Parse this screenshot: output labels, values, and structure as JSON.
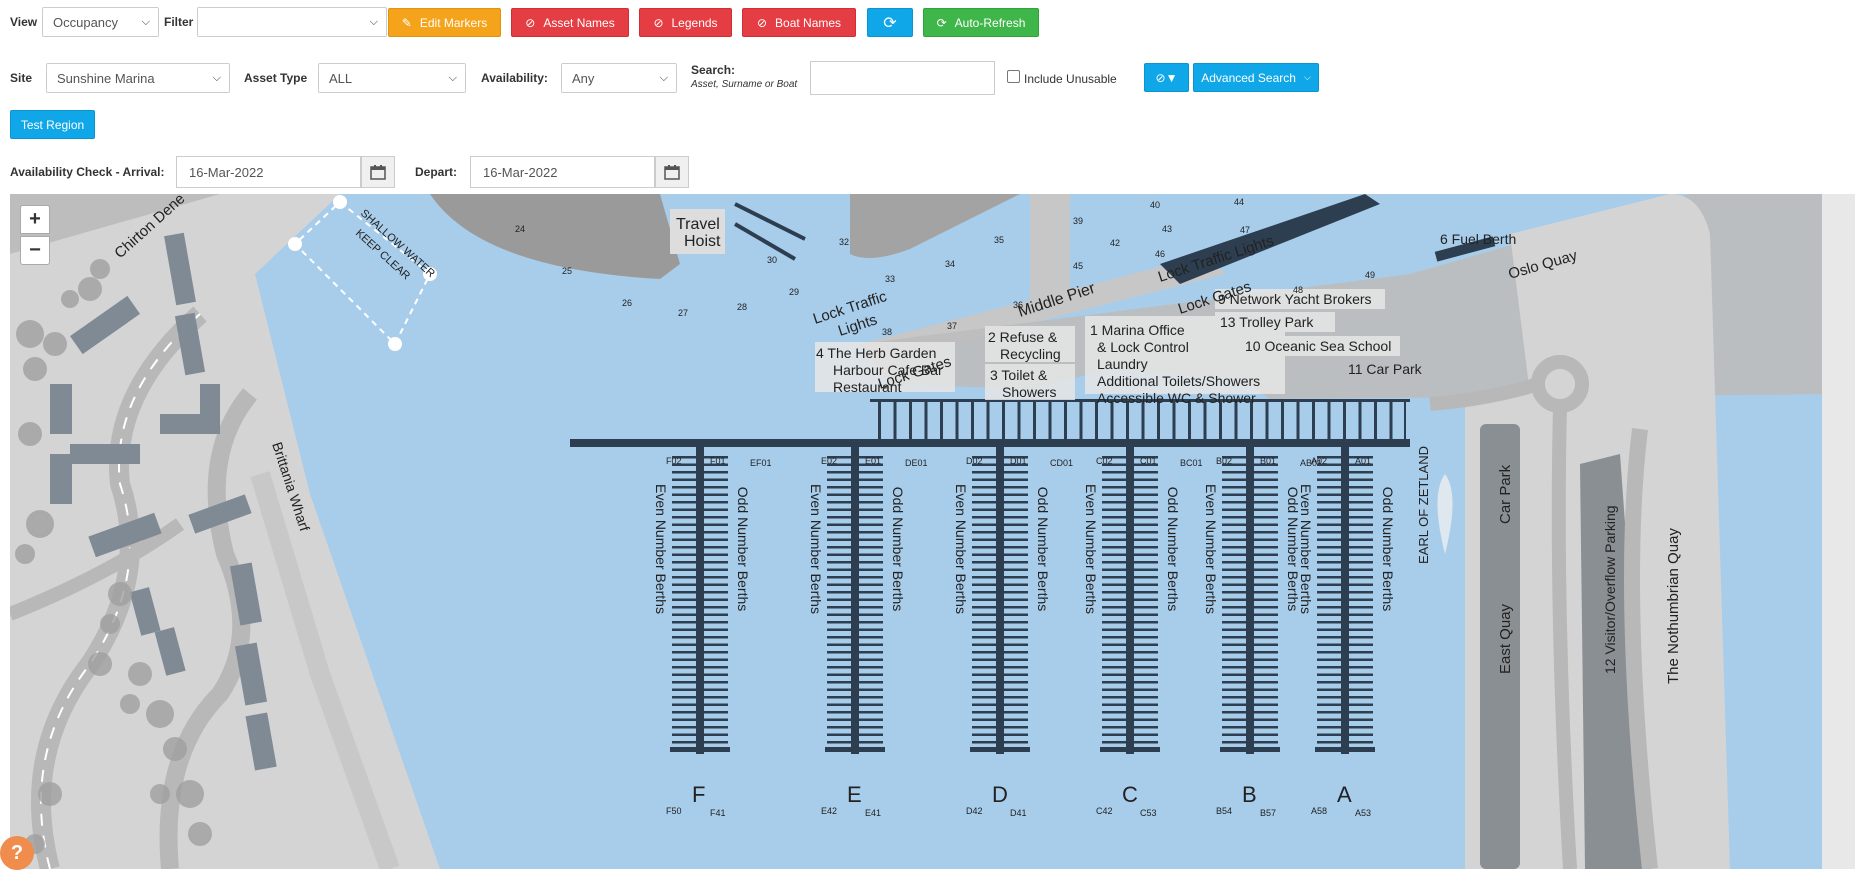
{
  "toolbar": {
    "view_label": "View",
    "view_value": "Occupancy",
    "filter_label": "Filter",
    "filter_value": "",
    "edit_markers": "Edit Markers",
    "asset_names": "Asset Names",
    "legends": "Legends",
    "boat_names": "Boat Names",
    "auto_refresh": "Auto-Refresh"
  },
  "search_row": {
    "site_label": "Site",
    "site_value": "Sunshine Marina",
    "asset_type_label": "Asset Type",
    "asset_type_value": "ALL",
    "availability_label": "Availability:",
    "availability_value": "Any",
    "search_label": "Search:",
    "search_hint": "Asset, Surname or Boat",
    "search_value": "",
    "include_unusable": "Include Unusable",
    "advanced_search": "Advanced Search"
  },
  "test_region": "Test Region",
  "availability": {
    "arrival_label": "Availability Check - Arrival:",
    "arrival_value": "16-Mar-2022",
    "depart_label": "Depart:",
    "depart_value": "16-Mar-2022"
  },
  "map": {
    "zoom_in": "+",
    "zoom_out": "−",
    "help": "?",
    "labels": {
      "chirton_dene": "Chirton Dene",
      "brittania_wharf": "Brittania Wharf",
      "shallow_water_1": "SHALLOW WATER",
      "shallow_water_2": "KEEP CLEAR",
      "travel_hoist_1": "Travel",
      "travel_hoist_2": "Hoist",
      "lock_traffic_lights_left_1": "Lock Traffic",
      "lock_traffic_lights_left_2": "Lights",
      "middle_pier": "Middle Pier",
      "lock_traffic_lights_right": "Lock Traffic Lights",
      "lock_gates_right": "Lock Gates",
      "lock_gates_left": "Lock Gates",
      "fuel_berth": "6 Fuel Berth",
      "oslo_quay": "Oslo Quay",
      "network_yacht_brokers": "9 Network Yacht Brokers",
      "trolley_park": "13 Trolley Park",
      "oceanic_sea_school": "10 Oceanic Sea School",
      "car_park_11": "11 Car Park",
      "marina_office_1": "1 Marina Office",
      "marina_office_2": "& Lock Control",
      "marina_office_3": "Laundry",
      "marina_office_4": "Additional Toilets/Showers",
      "marina_office_5": "Accessible WC & Shower",
      "refuse_1": "2 Refuse &",
      "refuse_2": "Recycling",
      "toilet_1": "3 Toilet &",
      "toilet_2": "Showers",
      "herb_garden_1": "4  The Herb Garden",
      "herb_garden_2": "Harbour Cafe Bar",
      "herb_garden_3": "Restaurant",
      "car_park": "Car Park",
      "east_quay": "East Quay",
      "visitor_parking": "12 Visitor/Overflow Parking",
      "northumbrian_quay": "The Nothumbrian Quay",
      "earl_of_zetland": "EARL OF ZETLAND",
      "even_berths": "Even Number Berths",
      "odd_berths": "Odd Number Berths"
    },
    "pontoons": [
      {
        "letter": "F",
        "conn": "EF01",
        "first_odd": "F01",
        "last_odd": "F41",
        "first_even": "F02",
        "last_even": "F50"
      },
      {
        "letter": "E",
        "conn": "DE01",
        "first_odd": "E01",
        "last_odd": "E41",
        "first_even": "E02",
        "last_even": "E42"
      },
      {
        "letter": "D",
        "conn": "CD01",
        "first_odd": "D01",
        "last_odd": "D41",
        "first_even": "D02",
        "last_even": "D42"
      },
      {
        "letter": "C",
        "conn": "BC01",
        "first_odd": "C01",
        "last_odd": "C53",
        "first_even": "C02",
        "last_even": "C42"
      },
      {
        "letter": "B",
        "conn": "AB01",
        "first_odd": "B01",
        "last_odd": "B57",
        "first_even": "B02",
        "last_even": "B54"
      },
      {
        "letter": "A",
        "conn": "",
        "first_odd": "A01",
        "last_odd": "A53",
        "first_even": "A02",
        "last_even": "A58"
      }
    ],
    "channel_numbers": [
      "24",
      "25",
      "26",
      "27",
      "28",
      "29",
      "30",
      "32",
      "33",
      "34",
      "35",
      "36",
      "37",
      "38",
      "39",
      "40",
      "42",
      "43",
      "44",
      "45",
      "46",
      "47",
      "48",
      "49"
    ]
  }
}
